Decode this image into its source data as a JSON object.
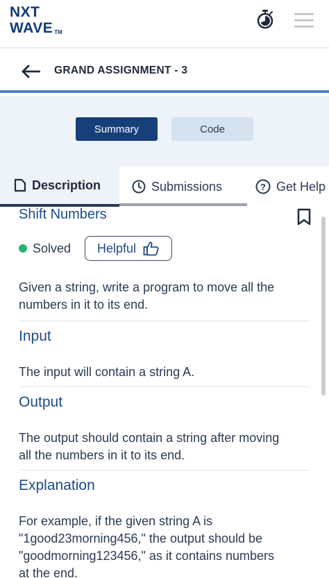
{
  "header": {
    "logo_line1": "NXT",
    "logo_line2": "WAVE",
    "logo_tm": "TM",
    "timer_icon": "stopwatch-icon",
    "menu_icon": "hamburger-menu-icon"
  },
  "assignment": {
    "title": "GRAND ASSIGNMENT - 3"
  },
  "toggle": {
    "summary_label": "Summary",
    "code_label": "Code",
    "active": "Summary"
  },
  "tabs": [
    {
      "label": "Description",
      "icon": "document-icon",
      "active": true
    },
    {
      "label": "Submissions",
      "icon": "clock-icon",
      "active": false
    },
    {
      "label": "Get Help",
      "icon": "question-circle-icon",
      "active": false
    }
  ],
  "problem": {
    "title": "Shift Numbers",
    "status": "Solved",
    "status_color": "#22b573",
    "helpful_label": "Helpful",
    "description": [
      "Given a string, write a program to move all the",
      "numbers in it to its end."
    ],
    "sections": {
      "input_heading": "Input",
      "input_text": "The input will contain a string A.",
      "output_heading": "Output",
      "output_text": [
        "The output should contain a string after moving",
        "all the numbers in it to its end."
      ],
      "explanation_heading": "Explanation",
      "explanation_text": [
        "For example, if the given string A is",
        "\"1good23morning456,\" the output should be",
        "\"goodmorning123456,\" as it contains numbers",
        "at the end."
      ]
    }
  },
  "colors": {
    "brand": "#123a78",
    "accent": "#173f7a",
    "heading": "#1e4a86"
  }
}
